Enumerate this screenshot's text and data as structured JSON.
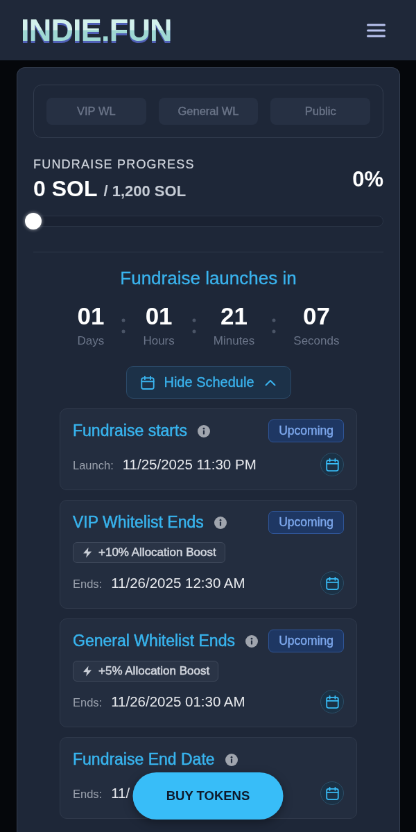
{
  "header": {
    "logo": "INDIE.FUN"
  },
  "phase_tabs": [
    {
      "label": "VIP WL",
      "selected": false
    },
    {
      "label": "General WL",
      "selected": false
    },
    {
      "label": "Public",
      "selected": false
    }
  ],
  "progress": {
    "title": "FUNDRAISE PROGRESS",
    "raised": "0 SOL",
    "goal": "/ 1,200 SOL",
    "percent": "0%",
    "level": 0
  },
  "countdown": {
    "title": "Fundraise launches in",
    "units": [
      {
        "value": "01",
        "label": "Days"
      },
      {
        "value": "01",
        "label": "Hours"
      },
      {
        "value": "21",
        "label": "Minutes"
      },
      {
        "value": "07",
        "label": "Seconds"
      }
    ]
  },
  "schedule_toggle": {
    "label": "Hide Schedule",
    "expanded": true
  },
  "schedule": [
    {
      "title": "Fundraise starts",
      "status": "Upcoming",
      "date_label": "Launch:",
      "date": "11/25/2025 11:30 PM"
    },
    {
      "title": "VIP Whitelist Ends",
      "status": "Upcoming",
      "boost": "+10% Allocation Boost",
      "date_label": "Ends:",
      "date": "11/26/2025 12:30 AM"
    },
    {
      "title": "General Whitelist Ends",
      "status": "Upcoming",
      "boost": "+5% Allocation Boost",
      "date_label": "Ends:",
      "date": "11/26/2025 01:30 AM"
    },
    {
      "title": "Fundraise End Date",
      "date_label": "Ends:",
      "date": "11/"
    }
  ],
  "buy_button": {
    "label": "BUY TOKENS"
  }
}
